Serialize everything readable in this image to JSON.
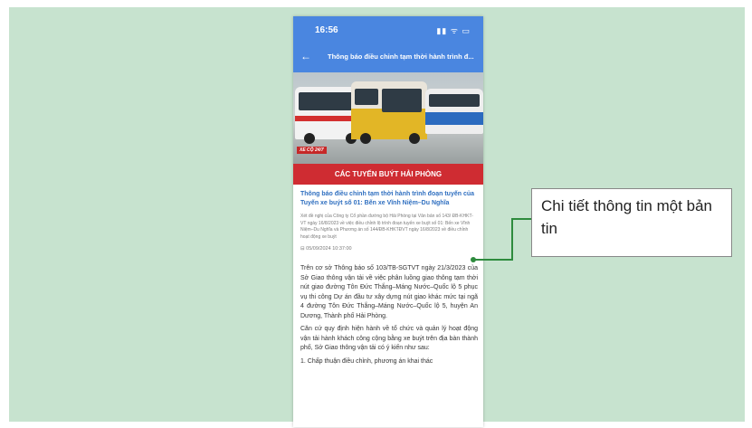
{
  "status_bar": {
    "time": "16:56",
    "icons": "▮▮ ᯤ ▭"
  },
  "app_bar": {
    "back_icon": "←",
    "title": "Thông báo điều chỉnh tạm thời hành trình đ..."
  },
  "banner": {
    "tag": "XE CỘ 24/7",
    "strip_text": "CÁC TUYẾN BUÝT HẢI PHÒNG"
  },
  "article": {
    "headline": "Thông báo điều chỉnh tạm thời hành trình đoạn tuyến của Tuyến xe buýt số 01: Bến xe Vĩnh Niệm–Du Nghĩa",
    "summary": "Xét đề nghị của Công ty Cổ phần đường bộ Hải Phòng tại Văn bản số 143/ ĐB-KHKT-VT ngày 16/8/2023 về việc điều chỉnh lộ trình đoạn tuyến xe buýt số 01: Bến xe Vĩnh Niệm–Du Nghĩa và Phương án số 144/ĐB-KHKTĐVT ngày 16/8/2023 về điều chỉnh hoạt động xe buýt",
    "date": "⊟ 05/09/2024 10:37:00",
    "paragraph_1": "Trên cơ sở Thông báo số 103/TB-SGTVT ngày 21/3/2023 của Sở Giao thông vận tải về việc phân luồng giao thông tạm thời nút giao đường Tôn Đức Thắng–Máng Nước–Quốc lộ 5 phục vụ thi công Dự án đầu tư xây dựng nút giao khác mức tại ngã 4 đường Tôn Đức Thắng–Máng Nước–Quốc lộ 5, huyện An Dương, Thành phố Hải Phòng.",
    "paragraph_2": "Căn cứ quy định hiện hành về tổ chức và quản lý hoạt động vận tải hành khách công cộng bằng xe buýt trên địa bàn thành phố, Sở Giao thông vận tải có ý kiến như sau:",
    "paragraph_3": "1. Chấp thuận điều chỉnh, phương án khai thác"
  },
  "callout": {
    "text": "Chi tiết thông tin một bản tin"
  }
}
